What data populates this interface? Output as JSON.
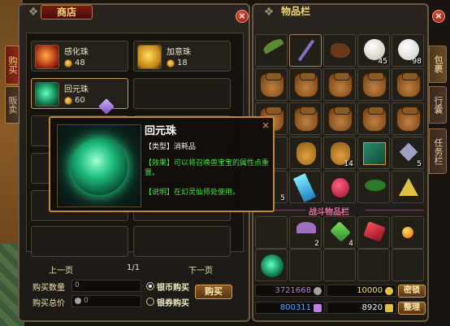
{
  "shop": {
    "title": "商店",
    "tabs": [
      {
        "label": "购买"
      },
      {
        "label": "贩卖"
      }
    ],
    "items": [
      {
        "name": "感化珠",
        "price": "48",
        "icon": "orange-orb-icon"
      },
      {
        "name": "加意珠",
        "price": "18",
        "icon": "gold-orb-icon"
      },
      {
        "name": "回元珠",
        "price": "60",
        "icon": "green-orb-icon"
      }
    ],
    "pager": {
      "prev": "上一页",
      "page": "1/1",
      "next": "下一页"
    },
    "quantity_label": "购买数量",
    "quantity_value": "0",
    "total_label": "购买总价",
    "total_value": "0",
    "currency_options": [
      {
        "label": "银币购买",
        "selected": true
      },
      {
        "label": "银券购买",
        "selected": false
      }
    ],
    "buy_label": "购买"
  },
  "tooltip": {
    "title": "回元珠",
    "type_line": "【类型】消耗品",
    "effect_line": "【效果】可以将召唤兽宝宝的属性点重置。",
    "desc_line": "【说明】在幻灵仙师处使用。",
    "close": "×"
  },
  "inventory": {
    "title": "物品栏",
    "tabs": [
      {
        "label": "包裹"
      },
      {
        "label": "行囊"
      },
      {
        "label": "任务栏"
      }
    ],
    "quantities": {
      "q_45": "45",
      "q_98": "98",
      "q_14": "14",
      "q_5a": "5",
      "q_5b": "5",
      "q_2": "2",
      "q_4": "4"
    },
    "battle_label": "战斗物品栏",
    "money": {
      "silver": "3721668",
      "gold": "10000",
      "voucher": "800311",
      "other": "8920"
    },
    "password_btn": "密锁",
    "sort_btn": "整理"
  },
  "colors": {
    "accent": "#c08a30",
    "panel_bg": "#1c1916",
    "effect_text": "#4ae04a",
    "battle_label": "#e070a0",
    "silver_value": "#c070e0",
    "gold_value": "#f0e060",
    "voucher_value": "#60a0ff"
  },
  "close_icon": "×"
}
